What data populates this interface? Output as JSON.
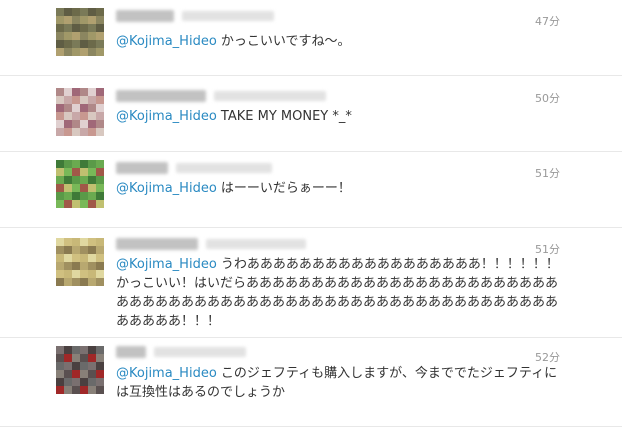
{
  "colors": {
    "mention": "#2a8ac2",
    "text": "#333333",
    "time": "#999999",
    "divider": "#e8e8e8"
  },
  "tweets": [
    {
      "time": "47分",
      "mention": "@Kojima_Hideo",
      "body": "かっこいいですね〜。",
      "avatar_colors": [
        "#7a7a58",
        "#a09868",
        "#6c6a4a",
        "#8b8660",
        "#5f5d44",
        "#b0a070"
      ]
    },
    {
      "time": "50分",
      "mention": "@Kojima_Hideo",
      "body": "TAKE MY MONEY *_*",
      "avatar_colors": [
        "#c8a8a8",
        "#b08888",
        "#d8c8c0",
        "#a06878",
        "#c89890",
        "#e0d0d0"
      ]
    },
    {
      "time": "51分",
      "mention": "@Kojima_Hideo",
      "body": "はーーいだらぁーー！",
      "avatar_colors": [
        "#5a9a48",
        "#78b858",
        "#3f7a38",
        "#c0c070",
        "#6aaa50",
        "#a05848"
      ]
    },
    {
      "time": "51分",
      "mention": "@Kojima_Hideo",
      "body": "うわああああああああああああああああああ！！！！！！かっこいい！はいだらあああああああああああああああああああああああああああああああああああああああああああああああああああああああああああああああ！！！",
      "avatar_colors": [
        "#b8a870",
        "#d0c080",
        "#8a7a50",
        "#e0d8a0",
        "#a09060",
        "#c8b878"
      ]
    },
    {
      "time": "52分",
      "mention": "@Kojima_Hideo",
      "body": "このジェフティも購入しますが、今まででたジェフティには互換性はあるのでしょうか",
      "avatar_colors": [
        "#6a6a6a",
        "#888078",
        "#4a4040",
        "#a02828",
        "#7a7070",
        "#5a5050"
      ]
    }
  ]
}
